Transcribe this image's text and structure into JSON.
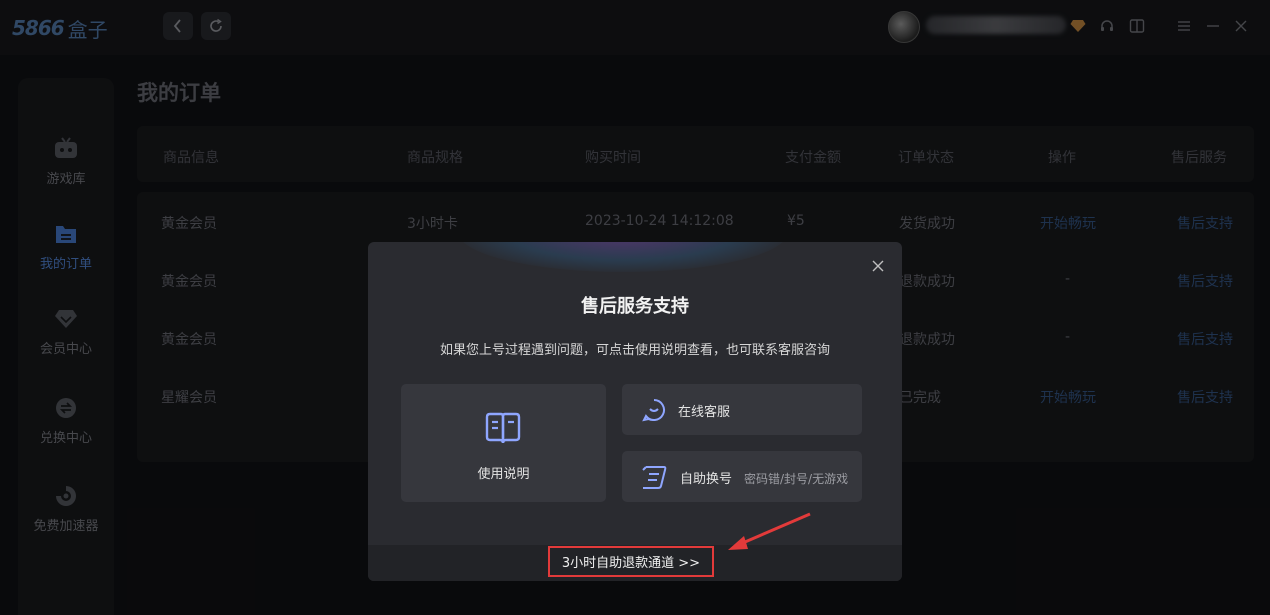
{
  "app": {
    "logo_num": "5866",
    "logo_cn": "盒子"
  },
  "topbar": {
    "back_icon": "chevron-left-icon",
    "refresh_icon": "refresh-icon",
    "right_icons": [
      "diamond-icon",
      "headset-icon",
      "window-icon",
      "menu-icon",
      "minimize-icon",
      "close-icon"
    ]
  },
  "sidebar": {
    "items": [
      {
        "label": "游戏库",
        "icon": "gamepad-icon"
      },
      {
        "label": "我的订单",
        "icon": "folder-icon",
        "active": true
      },
      {
        "label": "会员中心",
        "icon": "diamond-icon"
      },
      {
        "label": "兑换中心",
        "icon": "exchange-icon"
      },
      {
        "label": "免费加速器",
        "icon": "accelerator-icon"
      }
    ]
  },
  "page": {
    "title": "我的订单"
  },
  "table": {
    "columns": [
      "商品信息",
      "商品规格",
      "购买时间",
      "支付金额",
      "订单状态",
      "操作",
      "售后服务"
    ],
    "rows": [
      {
        "product": "黄金会员",
        "spec": "3小时卡",
        "time": "2023-10-24 14:12:08",
        "amount": "¥5",
        "status": "发货成功",
        "action": "开始畅玩",
        "service": "售后支持"
      },
      {
        "product": "黄金会员",
        "spec": "",
        "time": "",
        "amount": "",
        "status": "退款成功",
        "action": "-",
        "service": "售后支持"
      },
      {
        "product": "黄金会员",
        "spec": "",
        "time": "",
        "amount": "",
        "status": "退款成功",
        "action": "-",
        "service": "售后支持"
      },
      {
        "product": "星耀会员",
        "spec": "",
        "time": "",
        "amount": "",
        "status": "已完成",
        "action": "开始畅玩",
        "service": "售后支持"
      }
    ]
  },
  "modal": {
    "title": "售后服务支持",
    "description": "如果您上号过程遇到问题，可点击使用说明查看，也可联系客服咨询",
    "manual_label": "使用说明",
    "online_label": "在线客服",
    "self_label": "自助换号",
    "self_sub": "密码错/封号/无游戏",
    "refund_label": "3小时自助退款通道 >>",
    "close_icon": "close-icon"
  },
  "colors": {
    "accent": "#4b79c2",
    "highlight_border": "#e23a3a",
    "modal_bg": "#2a2b30",
    "card_icon": "#8fa6ff"
  }
}
